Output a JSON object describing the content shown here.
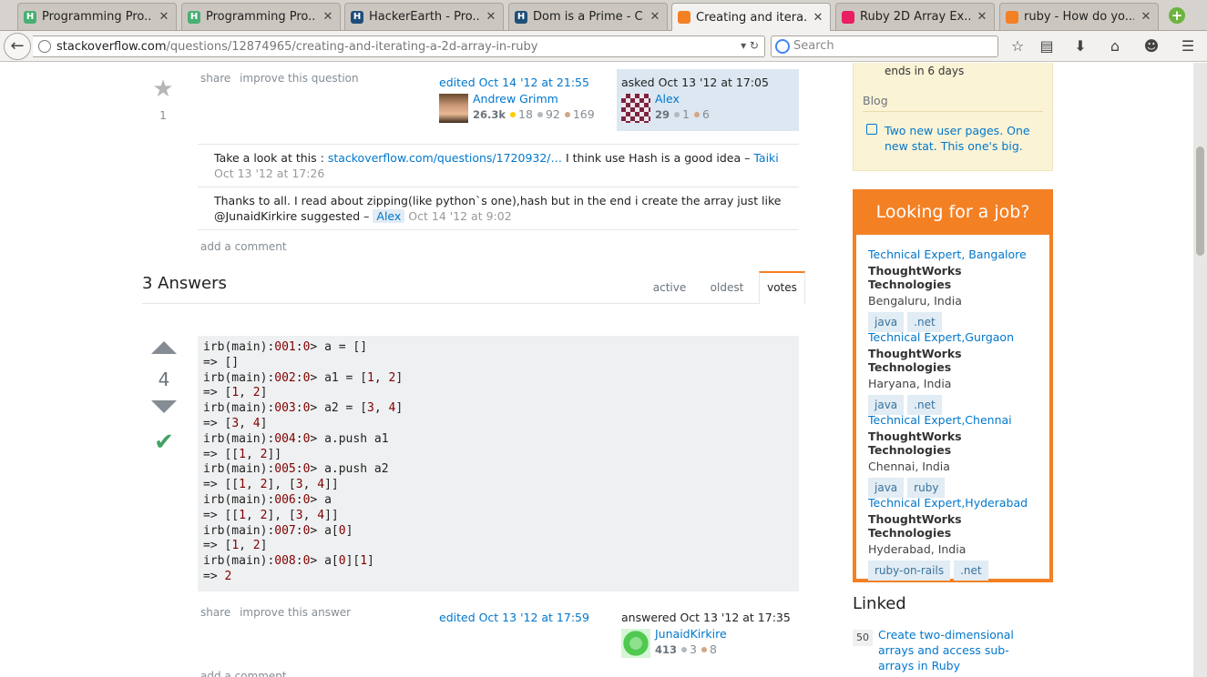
{
  "browser": {
    "tabs": [
      {
        "title": "Programming Pro...",
        "favicon": "hackerearth-h-icon",
        "fav_color": "#47b072"
      },
      {
        "title": "Programming Pro...",
        "favicon": "hackerearth-h-icon",
        "fav_color": "#47b072"
      },
      {
        "title": "HackerEarth - Pro...",
        "favicon": "hackerearth-logo-icon",
        "fav_color": "#1f4e79"
      },
      {
        "title": "Dom is a Prime - C...",
        "favicon": "hackerearth-logo-icon",
        "fav_color": "#1f4e79"
      },
      {
        "title": "Creating and itera...",
        "favicon": "stackoverflow-icon",
        "fav_color": "#f48024"
      },
      {
        "title": "Ruby 2D Array Ex...",
        "favicon": "multicolor-grid-icon",
        "fav_color": "#e91e63"
      },
      {
        "title": "ruby - How do yo...",
        "favicon": "stackoverflow-icon",
        "fav_color": "#f48024"
      }
    ],
    "url_host": "stackoverflow.com",
    "url_path": "/questions/12874965/creating-and-iterating-a-2d-array-in-ruby",
    "search_placeholder": "Search"
  },
  "question": {
    "favorite_count": "1",
    "menu": [
      "share",
      "improve this question"
    ],
    "edited": {
      "label": "edited Oct 14 '12 at 21:55",
      "user": "Andrew Grimm",
      "rep": "26.3k",
      "gold": "18",
      "silver": "92",
      "bronze": "169"
    },
    "asked": {
      "label": "asked Oct 13 '12 at 17:05",
      "user": "Alex",
      "rep": "29",
      "silver": "1",
      "bronze": "6"
    },
    "comments": [
      {
        "text_before": "Take a look at this : ",
        "link": "stackoverflow.com/questions/1720932/…",
        "text_after": " I think use Hash is a good idea –",
        "user": "Taiki",
        "time": "Oct 13 '12 at 17:26"
      },
      {
        "text": "Thanks to all. I read about zipping(like python`s one),hash but in the end i create the array just like @JunaidKirkire suggested –",
        "user": "Alex",
        "time": "Oct 14 '12 at 9:02"
      }
    ],
    "add_comment": "add a comment"
  },
  "answers": {
    "header": "3 Answers",
    "sort_tabs": [
      "active",
      "oldest",
      "votes"
    ],
    "selected_tab": "votes"
  },
  "answer": {
    "votes": "4",
    "code_lines": [
      [
        "irb(main):",
        "001",
        ":",
        "0",
        "> a = []"
      ],
      [
        "=> []"
      ],
      [
        "irb(main):",
        "002",
        ":",
        "0",
        "> a1 = [",
        "1",
        ", ",
        "2",
        "]"
      ],
      [
        "=> [",
        "1",
        ", ",
        "2",
        "]"
      ],
      [
        "irb(main):",
        "003",
        ":",
        "0",
        "> a2 = [",
        "3",
        ", ",
        "4",
        "]"
      ],
      [
        "=> [",
        "3",
        ", ",
        "4",
        "]"
      ],
      [
        "irb(main):",
        "004",
        ":",
        "0",
        "> a.push a1"
      ],
      [
        "=> [[",
        "1",
        ", ",
        "2",
        "]]"
      ],
      [
        "irb(main):",
        "005",
        ":",
        "0",
        "> a.push a2"
      ],
      [
        "=> [[",
        "1",
        ", ",
        "2",
        "], [",
        "3",
        ", ",
        "4",
        "]]"
      ],
      [
        "irb(main):",
        "006",
        ":",
        "0",
        "> a"
      ],
      [
        "=> [[",
        "1",
        ", ",
        "2",
        "], [",
        "3",
        ", ",
        "4",
        "]]"
      ],
      [
        "irb(main):",
        "007",
        ":",
        "0",
        "> a[",
        "0",
        "]"
      ],
      [
        "=> [",
        "1",
        ", ",
        "2",
        "]"
      ],
      [
        "irb(main):",
        "008",
        ":",
        "0",
        "> a[",
        "0",
        "][",
        "1",
        "]"
      ],
      [
        "=> ",
        "2"
      ]
    ],
    "menu": [
      "share",
      "improve this answer"
    ],
    "edited": {
      "label": "edited Oct 13 '12 at 17:59"
    },
    "answered": {
      "label": "answered Oct 13 '12 at 17:35",
      "user": "JunaidKirkire",
      "rep": "413",
      "silver": "3",
      "bronze": "8"
    },
    "add_comment": "add a comment"
  },
  "sidebar": {
    "community": {
      "ends": "ends in 6 days",
      "blog_label": "Blog",
      "blog_item": "Two new user pages. One new stat. This one's big."
    },
    "jobs": {
      "header": "Looking for a job?",
      "items": [
        {
          "title": "Technical Expert, Bangalore",
          "company": "ThoughtWorks Technologies",
          "location": "Bengaluru, India",
          "tags": [
            "java",
            ".net"
          ]
        },
        {
          "title": "Technical Expert,Gurgaon",
          "company": "ThoughtWorks Technologies",
          "location": "Haryana, India",
          "tags": [
            "java",
            ".net"
          ]
        },
        {
          "title": "Technical Expert,Chennai",
          "company": "ThoughtWorks Technologies",
          "location": "Chennai, India",
          "tags": [
            "java",
            "ruby"
          ]
        },
        {
          "title": "Technical Expert,Hyderabad",
          "company": "ThoughtWorks Technologies",
          "location": "Hyderabad, India",
          "tags": [
            "ruby-on-rails",
            ".net"
          ]
        }
      ]
    },
    "linked": {
      "title": "Linked",
      "items": [
        {
          "count": "50",
          "title": "Create two-dimensional arrays and access sub-arrays in Ruby"
        }
      ]
    }
  },
  "colors": {
    "accent": "#f48024",
    "link": "#0077cc",
    "accepted": "#45a163"
  }
}
